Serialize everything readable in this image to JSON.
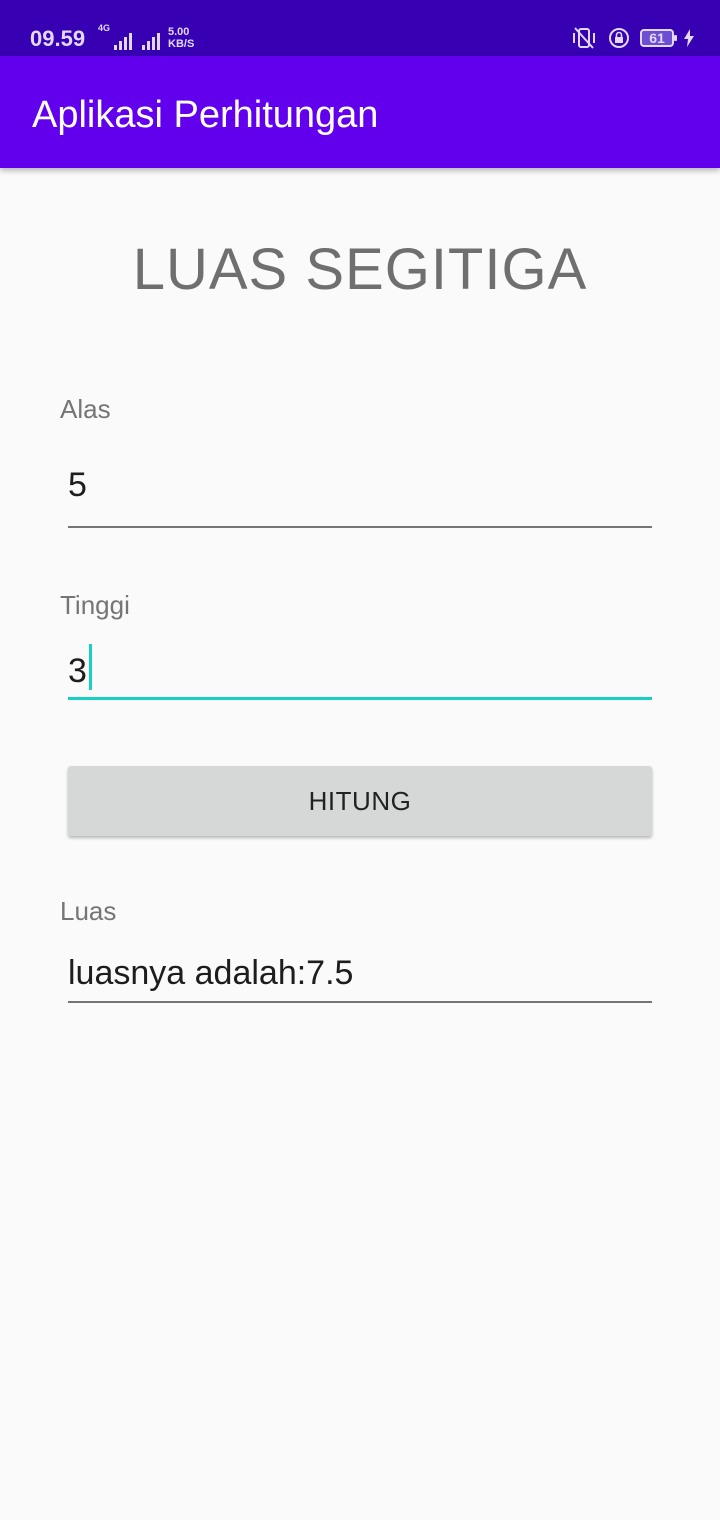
{
  "status_bar": {
    "time": "09.59",
    "network_type": "4G",
    "speed_value": "5.00",
    "speed_unit": "KB/S",
    "battery": "61",
    "icons": [
      "signal-icon",
      "vibrate-icon",
      "lock-rotation-icon",
      "battery-icon",
      "charging-icon"
    ]
  },
  "app_bar": {
    "title": "Aplikasi Perhitungan",
    "color": "#6200ee"
  },
  "main": {
    "title": "LUAS SEGITIGA",
    "alas_label": "Alas",
    "alas_value": "5",
    "tinggi_label": "Tinggi",
    "tinggi_value": "3",
    "button_label": "HITUNG",
    "luas_label": "Luas",
    "luas_value": "luasnya adalah:7.5"
  },
  "colors": {
    "status_bar": "#3700b3",
    "accent": "#18cfc3",
    "background": "#fafafa"
  }
}
